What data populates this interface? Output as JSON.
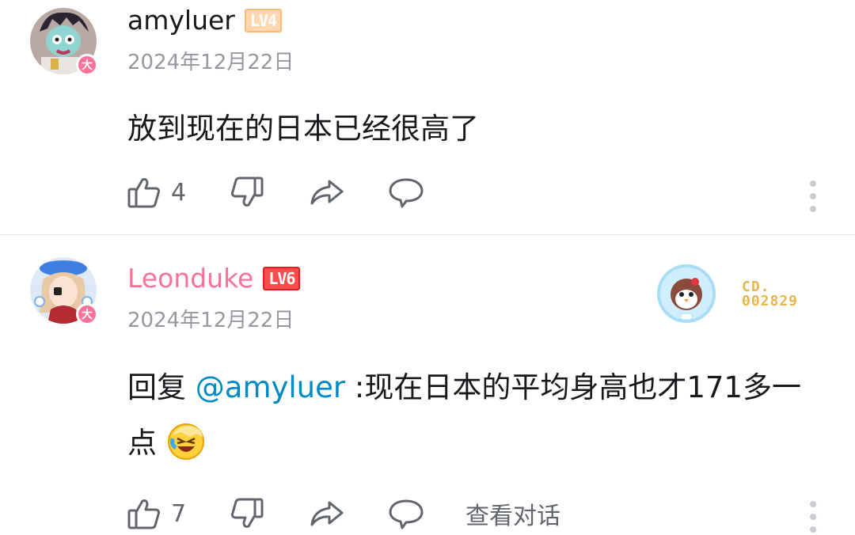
{
  "comments": [
    {
      "username": "amyluer",
      "level": "LV4",
      "vip_badge": "大",
      "date": "2024年12月22日",
      "content": "放到现在的日本已经很高了",
      "like_count": "4"
    },
    {
      "username": "Leonduke",
      "level": "LV6",
      "vip_badge": "大",
      "date": "2024年12月22日",
      "reply_prefix": "回复 ",
      "mention": "@amyluer",
      "content_after": " :现在日本的平均身高也才171多一点",
      "like_count": "7",
      "view_conversation": "查看对话",
      "card_label": "CD.",
      "card_number": "002829"
    }
  ],
  "colors": {
    "vip_pink": "#fb7299",
    "mention_blue": "#008ac5",
    "meta_gray": "#9499a0",
    "action_gray": "#61666d"
  },
  "icons": [
    "thumb-up-icon",
    "thumb-down-icon",
    "share-icon",
    "reply-bubble-icon",
    "more-vertical-icon",
    "laughing-crying-emote"
  ]
}
